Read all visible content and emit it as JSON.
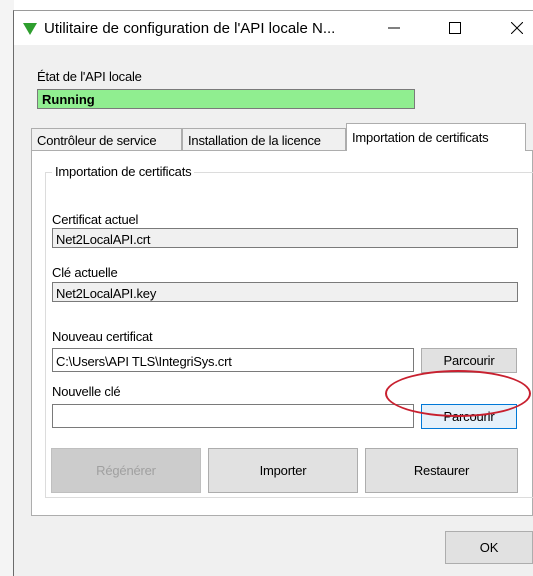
{
  "window": {
    "title": "Utilitaire de configuration de l'API locale N...",
    "controls": {
      "minimize": "minimize",
      "maximize": "maximize",
      "close": "close"
    }
  },
  "status": {
    "label": "État de l'API locale",
    "value": "Running",
    "color": "#90ee90"
  },
  "tabs": [
    {
      "label": "Contrôleur de service",
      "active": false
    },
    {
      "label": "Installation de la licence",
      "active": false
    },
    {
      "label": "Importation de certificats",
      "active": true
    }
  ],
  "import_group": {
    "title": "Importation de certificats",
    "current_cert_label": "Certificat actuel",
    "current_cert_value": "Net2LocalAPI.crt",
    "current_key_label": "Clé actuelle",
    "current_key_value": "Net2LocalAPI.key",
    "new_cert_label": "Nouveau certificat",
    "new_cert_value": "C:\\Users\\API TLS\\IntegriSys.crt",
    "new_key_label": "Nouvelle clé",
    "new_key_value": "",
    "browse_cert_label": "Parcourir",
    "browse_key_label": "Parcourir",
    "regenerate_label": "Régénérer",
    "import_label": "Importer",
    "restore_label": "Restaurer"
  },
  "footer": {
    "ok_label": "OK"
  },
  "annotation": {
    "color": "#c8202f",
    "target": "browse-key-button"
  },
  "icons": [
    "app-triangle-icon",
    "minimize-icon",
    "maximize-icon",
    "close-icon"
  ]
}
